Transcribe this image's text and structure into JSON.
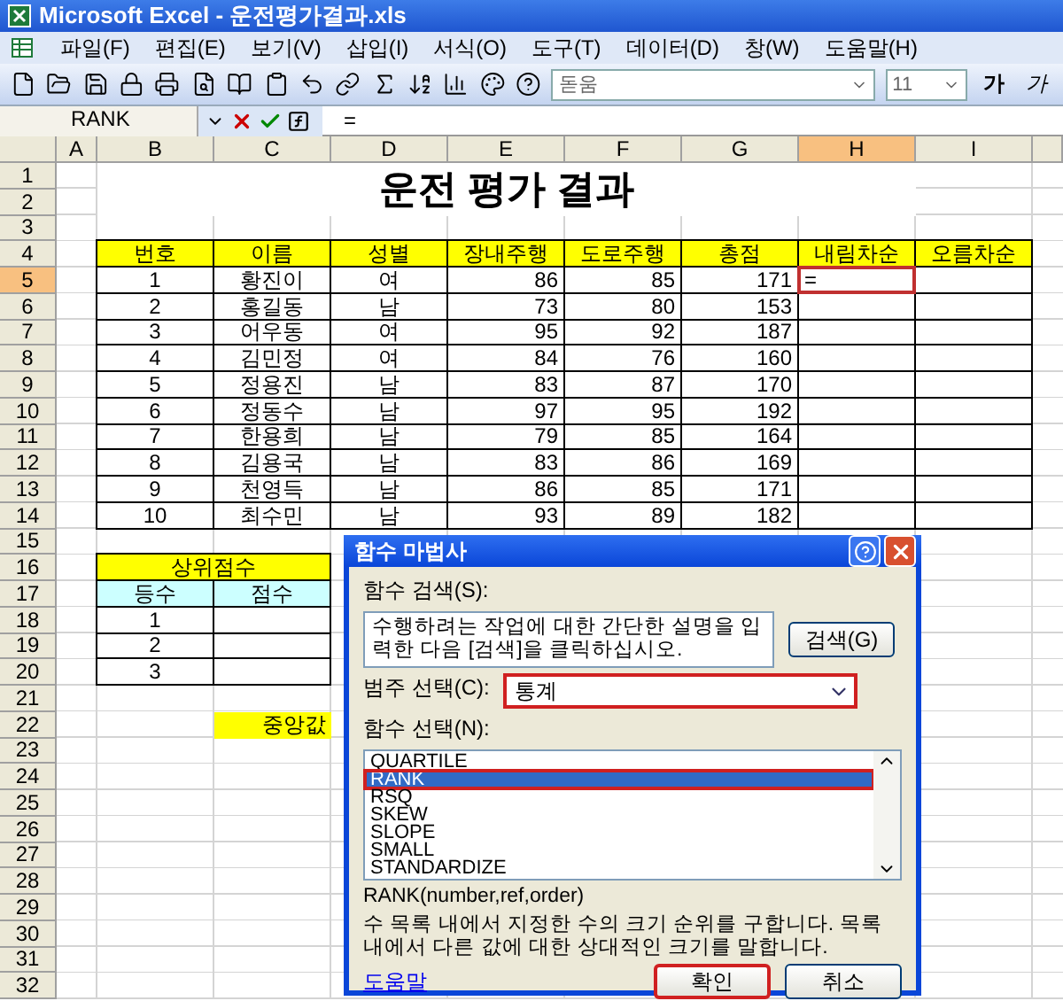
{
  "window": {
    "title": "Microsoft Excel - 운전평가결과.xls"
  },
  "menu": [
    "파일(F)",
    "편집(E)",
    "보기(V)",
    "삽입(I)",
    "서식(O)",
    "도구(T)",
    "데이터(D)",
    "창(W)",
    "도움말(H)"
  ],
  "toolbar": {
    "font_name": "돋움",
    "font_size": "11",
    "style_buttons": [
      {
        "kind": "bold",
        "label": "가"
      },
      {
        "kind": "italic",
        "label": "가"
      }
    ]
  },
  "formula_bar": {
    "name_box": "RANK",
    "formula": "="
  },
  "sheet": {
    "columns": [
      {
        "label": "A",
        "selected": false
      },
      {
        "label": "B",
        "selected": false
      },
      {
        "label": "C",
        "selected": false
      },
      {
        "label": "D",
        "selected": false
      },
      {
        "label": "E",
        "selected": false
      },
      {
        "label": "F",
        "selected": false
      },
      {
        "label": "G",
        "selected": false
      },
      {
        "label": "H",
        "selected": true
      },
      {
        "label": "I",
        "selected": false
      }
    ],
    "rows": [
      {
        "label": "1",
        "selected": false
      },
      {
        "label": "2",
        "selected": false
      },
      {
        "label": "3",
        "selected": false
      },
      {
        "label": "4",
        "selected": false
      },
      {
        "label": "5",
        "selected": true
      },
      {
        "label": "6",
        "selected": false
      },
      {
        "label": "7",
        "selected": false
      },
      {
        "label": "8",
        "selected": false
      },
      {
        "label": "9",
        "selected": false
      },
      {
        "label": "10",
        "selected": false
      },
      {
        "label": "11",
        "selected": false
      },
      {
        "label": "12",
        "selected": false
      },
      {
        "label": "13",
        "selected": false
      },
      {
        "label": "14",
        "selected": false
      },
      {
        "label": "15",
        "selected": false
      },
      {
        "label": "16",
        "selected": false
      },
      {
        "label": "17",
        "selected": false
      },
      {
        "label": "18",
        "selected": false
      },
      {
        "label": "19",
        "selected": false
      },
      {
        "label": "20",
        "selected": false
      },
      {
        "label": "21",
        "selected": false
      },
      {
        "label": "22",
        "selected": false
      },
      {
        "label": "23",
        "selected": false
      },
      {
        "label": "24",
        "selected": false
      },
      {
        "label": "25",
        "selected": false
      },
      {
        "label": "26",
        "selected": false
      },
      {
        "label": "27",
        "selected": false
      },
      {
        "label": "28",
        "selected": false
      },
      {
        "label": "29",
        "selected": false
      },
      {
        "label": "30",
        "selected": false
      },
      {
        "label": "31",
        "selected": false
      },
      {
        "label": "32",
        "selected": false
      }
    ],
    "title": "운전 평가 결과",
    "table": {
      "headers": [
        "번호",
        "이름",
        "성별",
        "장내주행",
        "도로주행",
        "총점",
        "내림차순",
        "오름차순"
      ],
      "rows": [
        [
          "1",
          "황진이",
          "여",
          "86",
          "85",
          "171"
        ],
        [
          "2",
          "홍길동",
          "남",
          "73",
          "80",
          "153"
        ],
        [
          "3",
          "어우동",
          "여",
          "95",
          "92",
          "187"
        ],
        [
          "4",
          "김민정",
          "여",
          "84",
          "76",
          "160"
        ],
        [
          "5",
          "정용진",
          "남",
          "83",
          "87",
          "170"
        ],
        [
          "6",
          "정동수",
          "남",
          "97",
          "95",
          "192"
        ],
        [
          "7",
          "한용희",
          "남",
          "79",
          "85",
          "164"
        ],
        [
          "8",
          "김용국",
          "남",
          "83",
          "86",
          "169"
        ],
        [
          "9",
          "천영득",
          "남",
          "86",
          "85",
          "171"
        ],
        [
          "10",
          "최수민",
          "남",
          "93",
          "89",
          "182"
        ]
      ]
    },
    "active_cell": {
      "value": "="
    },
    "top_scores": {
      "title": "상위점수",
      "headers": [
        "등수",
        "점수"
      ],
      "ranks": [
        "1",
        "2",
        "3"
      ]
    },
    "median_label": "중앙값"
  },
  "dialog": {
    "title": "함수 마법사",
    "search_label": "함수 검색(S):",
    "search_value": "수행하려는 작업에 대한 간단한 설명을 입력한 다음 [검색]을 클릭하십시오.",
    "search_button": "검색(G)",
    "category_label": "범주 선택(C):",
    "category": {
      "value": "통계",
      "highlighted": true
    },
    "function_label": "함수 선택(N):",
    "functions": [
      {
        "name": "QUARTILE",
        "selected": false,
        "highlighted": false
      },
      {
        "name": "RANK",
        "selected": true,
        "highlighted": true
      },
      {
        "name": "RSQ",
        "selected": false,
        "highlighted": false
      },
      {
        "name": "SKEW",
        "selected": false,
        "highlighted": false
      },
      {
        "name": "SLOPE",
        "selected": false,
        "highlighted": false
      },
      {
        "name": "SMALL",
        "selected": false,
        "highlighted": false
      },
      {
        "name": "STANDARDIZE",
        "selected": false,
        "highlighted": false
      }
    ],
    "signature": "RANK(number,ref,order)",
    "description": "수 목록 내에서 지정한 수의 크기 순위를 구합니다. 목록 내에서 다른 값에 대한 상대적인 크기를 말합니다.",
    "help_link": "도움말",
    "ok": {
      "label": "확인",
      "highlighted": true
    },
    "cancel": "취소"
  }
}
